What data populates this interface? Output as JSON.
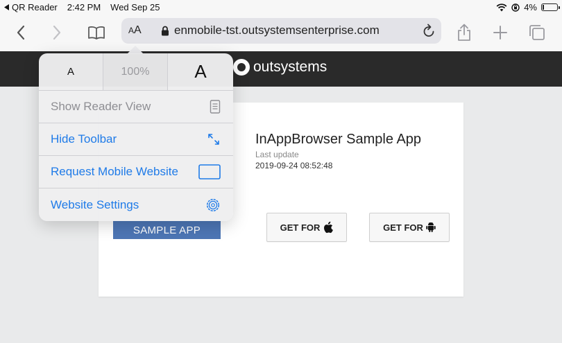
{
  "status_bar": {
    "back_app": "QR Reader",
    "time": "2:42 PM",
    "date": "Wed Sep 25",
    "battery": "4%",
    "battery_level": 0.04
  },
  "toolbar": {
    "aa_small": "A",
    "aa_large": "A",
    "url": "enmobile-tst.outsystemsenterprise.com",
    "icons": [
      "back-chevron-icon",
      "forward-chevron-icon",
      "bookmarks-book-icon",
      "lock-icon",
      "reload-icon",
      "share-icon",
      "new-tab-plus-icon",
      "tabs-icon"
    ]
  },
  "page": {
    "brand": "outsystems",
    "app_title": "InAppBrowser Sample App",
    "last_update_label": "Last update",
    "last_update_value": "2019-09-24 08:52:48",
    "sample_button": "SAMPLE APP",
    "get_ios": "GET FOR",
    "get_android": "GET FOR"
  },
  "popover": {
    "zoom_small": "A",
    "zoom_percent": "100%",
    "zoom_large": "A",
    "items": [
      {
        "label": "Show Reader View",
        "icon": "reader-view-icon",
        "enabled": false
      },
      {
        "label": "Hide Toolbar",
        "icon": "hide-toolbar-arrows-icon",
        "enabled": true
      },
      {
        "label": "Request Mobile Website",
        "icon": "mobile-website-icon",
        "enabled": true
      },
      {
        "label": "Website Settings",
        "icon": "gear-icon",
        "enabled": true
      }
    ]
  },
  "colors": {
    "accent": "#1f7be8",
    "header_bg": "#2a2a2a",
    "sample_button_bg": "#4d76b5"
  }
}
